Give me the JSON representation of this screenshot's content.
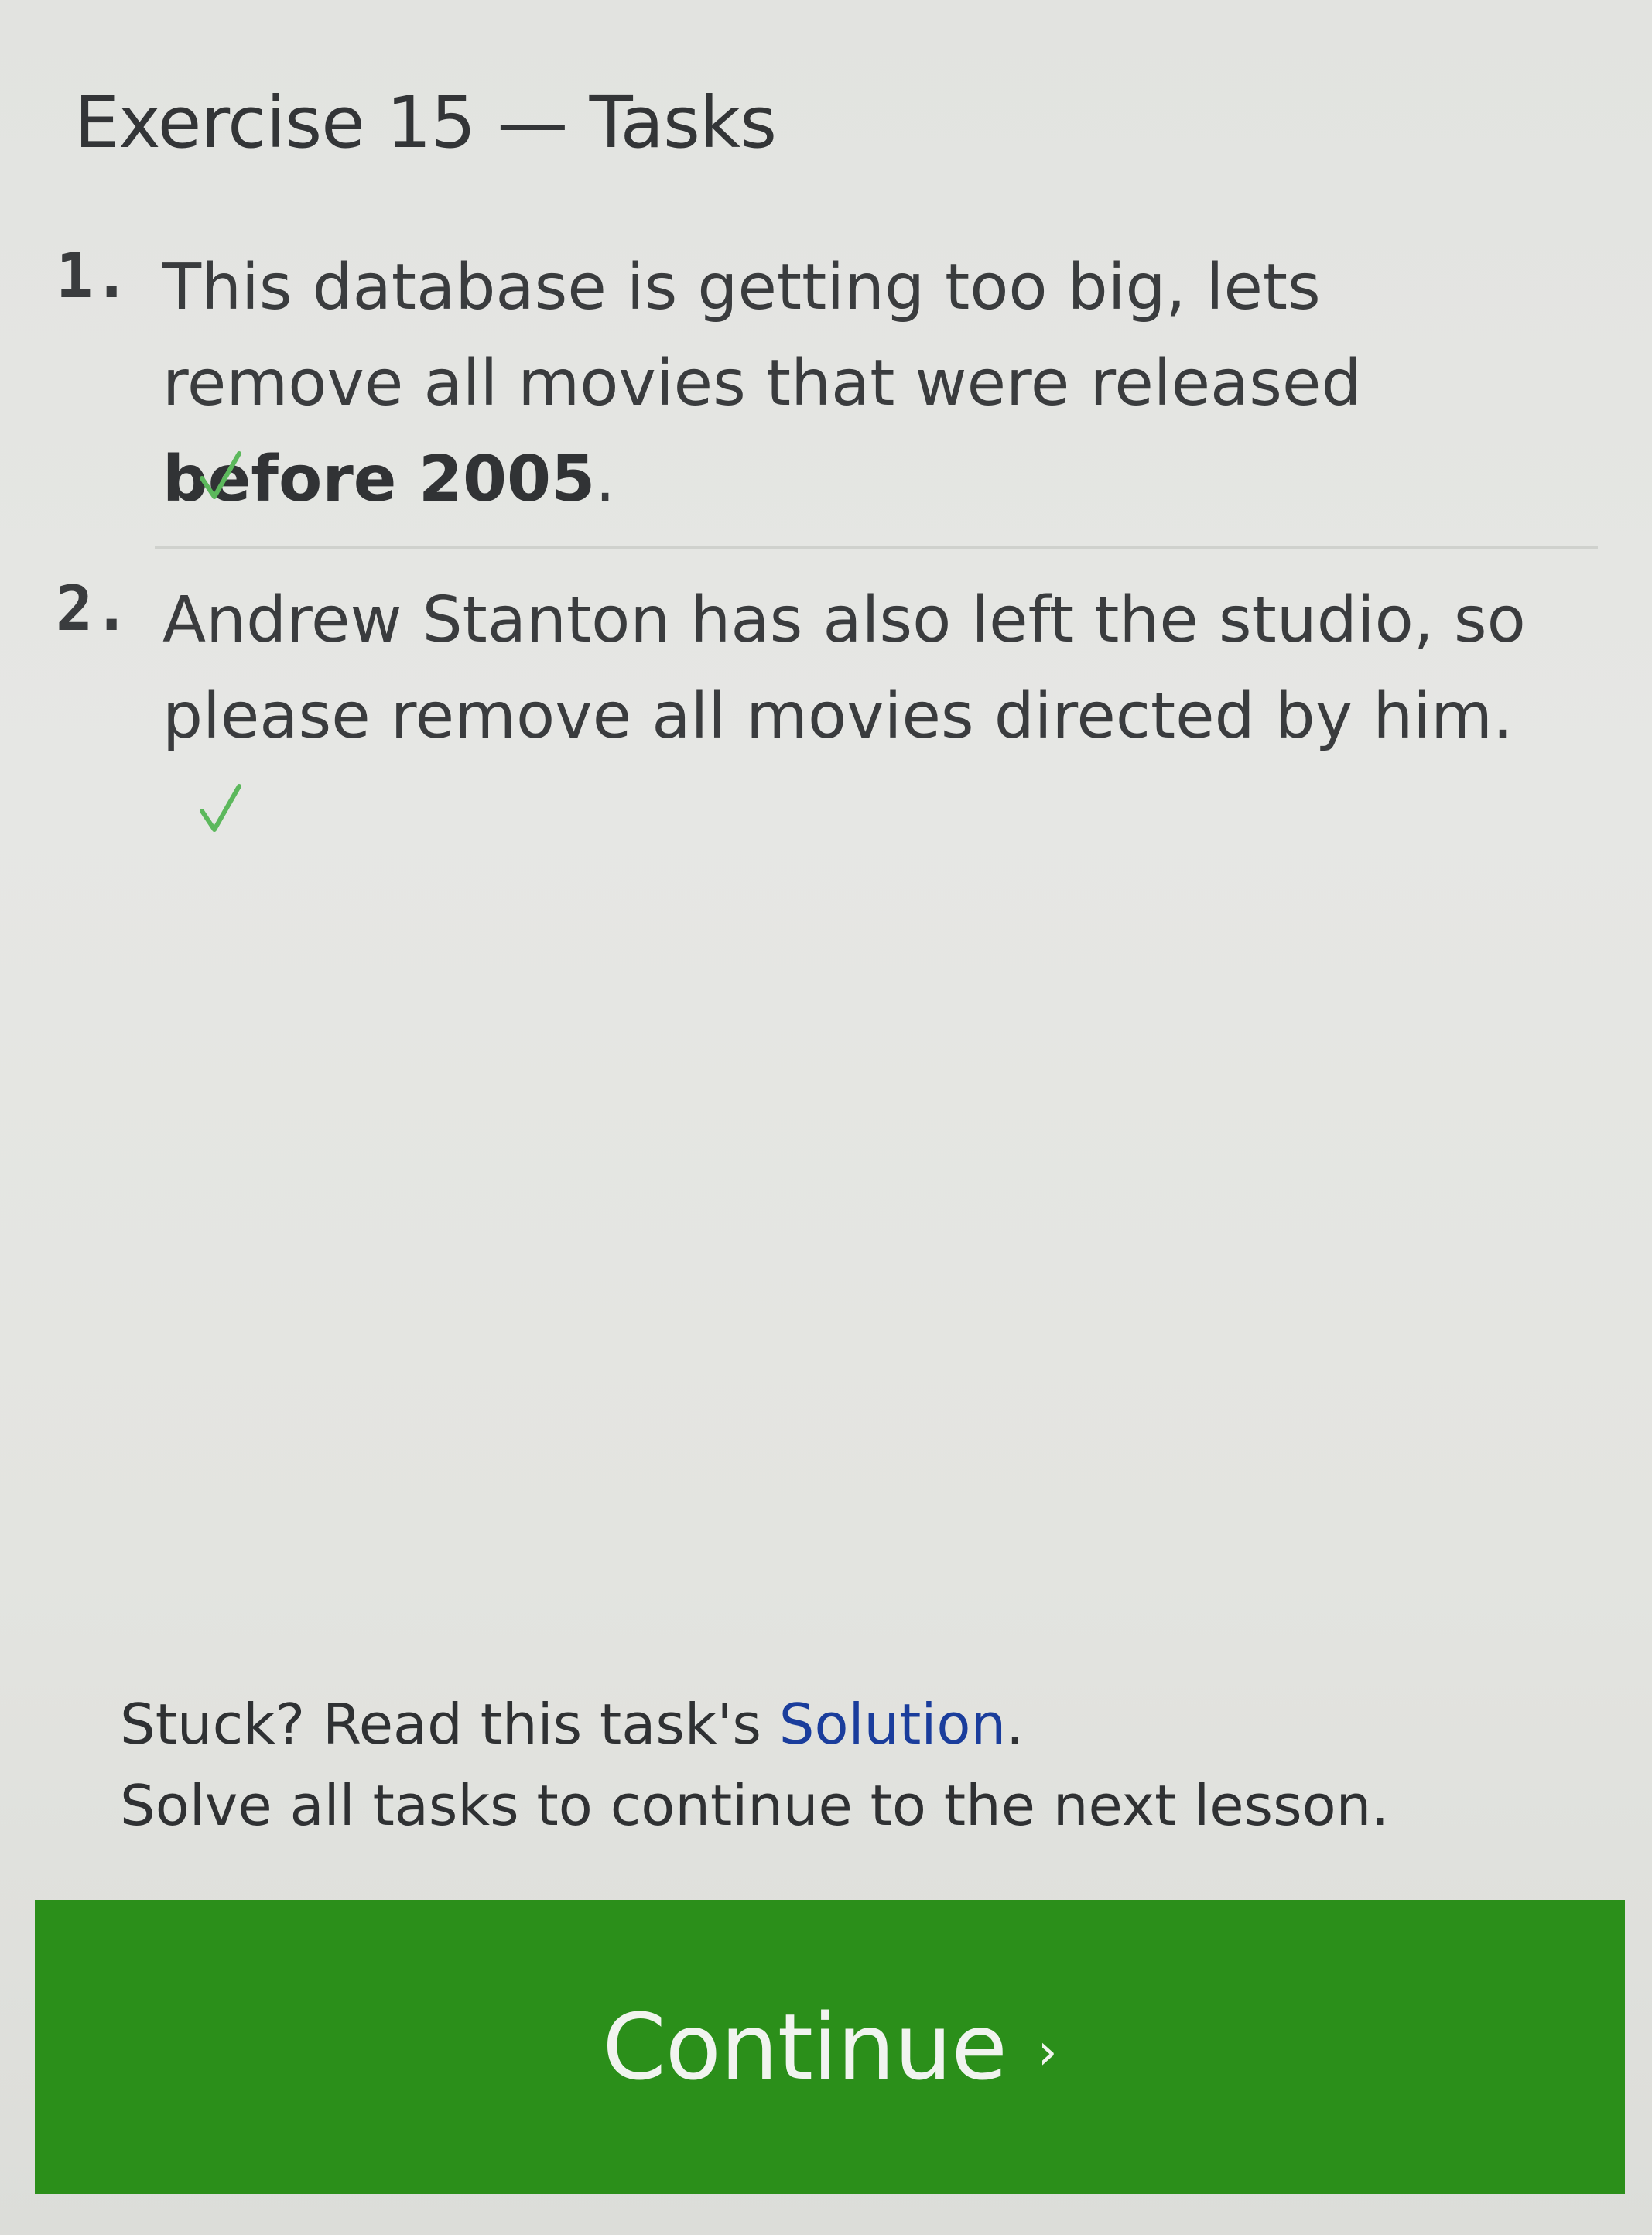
{
  "exercise": {
    "title": "Exercise 15 — Tasks"
  },
  "tasks": [
    {
      "number": "1.",
      "text_before": "This database is getting too big, lets remove all movies that were released ",
      "text_bold": "before 2005",
      "text_after": ".",
      "status": "complete"
    },
    {
      "number": "2.",
      "text": "Andrew Stanton has also left the studio, so please remove all movies directed by him.",
      "status": "complete"
    }
  ],
  "footer": {
    "stuck_prefix": "Stuck? Read this task's ",
    "solution_link": "Solution",
    "stuck_suffix": ".",
    "solve_all": "Solve all tasks to continue to the next lesson."
  },
  "continue_button": {
    "label": "Continue",
    "chevron": "›"
  },
  "colors": {
    "accent_green": "#2b8f1a",
    "check_green": "#5cb85c",
    "link_blue": "#1a3d9c"
  },
  "icons": {
    "check": "check-icon",
    "chevron": "chevron-right-icon"
  }
}
